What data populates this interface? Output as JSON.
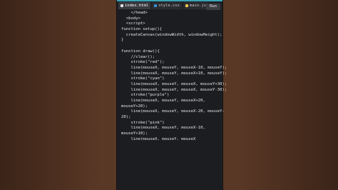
{
  "tabs": [
    {
      "label": "index.html",
      "icon": "html-file-icon",
      "active": true
    },
    {
      "label": "style.css",
      "icon": "css-file-icon",
      "active": false
    },
    {
      "label": "main.js",
      "icon": "js-file-icon",
      "active": false
    }
  ],
  "run_label": "Run",
  "code_lines": [
    "    </head>",
    "  <body>",
    "  <script>",
    "function setup(){",
    "  createCanvas(windowWidth, windowHeight);",
    "}",
    "",
    "function draw(){",
    "    //clear();",
    "    stroke(\"red\");",
    "    line(mouseX, mouseY, mouseX-10, mouseY);",
    "    line(mouseX, mouseY, mouseX+10, mouseY);",
    "    stroke(\"cyan\")",
    "    line(mouseX, mouseY, mouseX, mouseY+30);",
    "    line(mouseX, mouseY, mouseX, mouseY-30);",
    "    stroke(\"purple\")",
    "    line(mouseX, mouseY, mouseX+20,",
    "mouseY+20);",
    "    line(mouseX, mouseY, mouseX-20, mouseY-",
    "20);",
    "    stroke(\"pink\")",
    "    line(mouseX, mouseY, mouseX-10,",
    "mouseY+10);",
    "    line(mouseX, mouseY, mouseX"
  ]
}
